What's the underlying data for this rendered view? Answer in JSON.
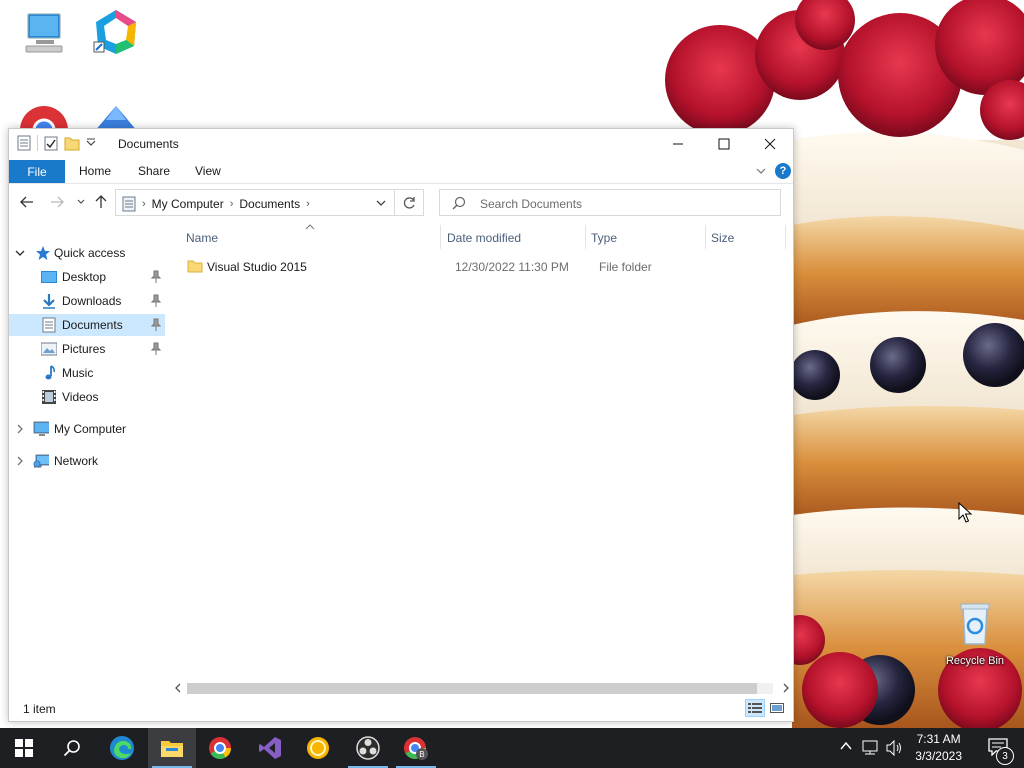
{
  "window": {
    "title": "Documents"
  },
  "ribbon": {
    "tabs": [
      "File",
      "Home",
      "Share",
      "View"
    ],
    "help_label": "?"
  },
  "address_bar": {
    "crumbs": [
      "My Computer",
      "Documents"
    ]
  },
  "search": {
    "placeholder": "Search Documents"
  },
  "nav_pane": {
    "quick_access": "Quick access",
    "items": [
      {
        "label": "Desktop",
        "pinned": true
      },
      {
        "label": "Downloads",
        "pinned": true
      },
      {
        "label": "Documents",
        "pinned": true,
        "selected": true
      },
      {
        "label": "Pictures",
        "pinned": true
      },
      {
        "label": "Music",
        "pinned": false
      },
      {
        "label": "Videos",
        "pinned": false
      }
    ],
    "my_computer": "My Computer",
    "network": "Network"
  },
  "file_list": {
    "columns": [
      "Name",
      "Date modified",
      "Type",
      "Size"
    ],
    "rows": [
      {
        "name": "Visual Studio 2015",
        "date_modified": "12/30/2022 11:30 PM",
        "type": "File folder",
        "size": ""
      }
    ]
  },
  "status_bar": {
    "item_count": "1 item"
  },
  "desktop": {
    "recycle_bin": "Recycle Bin"
  },
  "taskbar": {
    "time": "7:31 AM",
    "date": "3/3/2023",
    "notification_count": "3"
  },
  "colors": {
    "accent": "#1979ca",
    "selection": "#cce8ff",
    "taskbar": "#1e1f22"
  }
}
